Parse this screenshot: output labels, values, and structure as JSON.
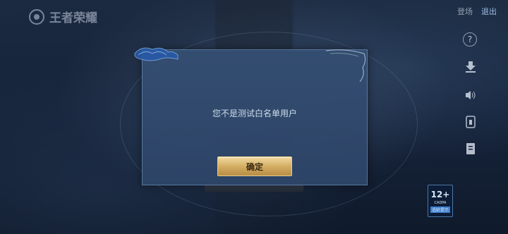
{
  "brand": {
    "logo_text": "王者荣耀"
  },
  "top_bar": {
    "link1": "登场",
    "link2": "退出"
  },
  "side_icons": [
    "help-icon",
    "download-icon",
    "sound-icon",
    "info-icon",
    "notice-icon"
  ],
  "age_rating": {
    "age": "12+",
    "small": "CADPA",
    "tag": "适龄提示"
  },
  "dialog": {
    "message": "您不是测试白名单用户",
    "confirm_label": "确定"
  },
  "colors": {
    "dialog_bg": "#344e72",
    "button_gold": "#d4ae64",
    "message_text": "#cfdcea"
  }
}
